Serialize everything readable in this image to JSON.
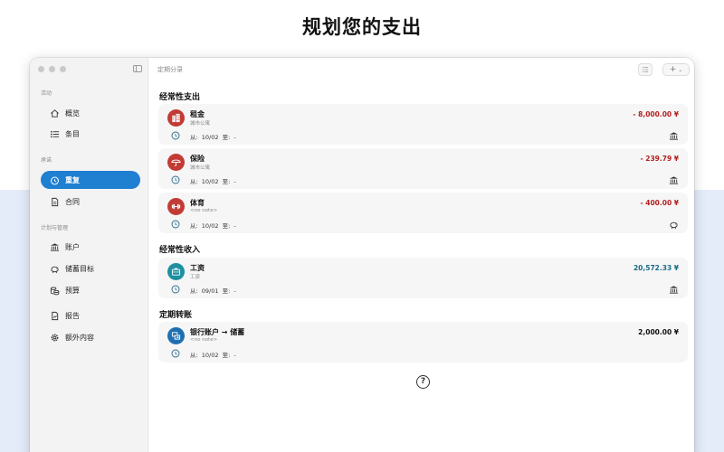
{
  "headline": "规划您的支出",
  "window": {
    "title": "定期分录"
  },
  "sidebar": {
    "sections": [
      {
        "label": "活动"
      },
      {
        "label": "承诺"
      },
      {
        "label": "计划与管理"
      }
    ],
    "items": [
      {
        "label": "概览",
        "icon": "home-icon"
      },
      {
        "label": "条目",
        "icon": "list-icon"
      },
      {
        "label": "重复",
        "icon": "repeat-clock-icon",
        "active": true
      },
      {
        "label": "合同",
        "icon": "document-icon"
      },
      {
        "label": "账户",
        "icon": "bank-icon"
      },
      {
        "label": "储蓄目标",
        "icon": "piggy-bank-icon"
      },
      {
        "label": "预算",
        "icon": "coins-icon"
      },
      {
        "label": "报告",
        "icon": "report-icon"
      },
      {
        "label": "额外内容",
        "icon": "gear-icon"
      }
    ]
  },
  "groups": [
    {
      "title": "经常性支出"
    },
    {
      "title": "经常性收入"
    },
    {
      "title": "定期转账"
    }
  ],
  "entries": [
    {
      "name": "租金",
      "sub": "城市公寓",
      "amount": "- 8,000.00 ¥",
      "from_label": "从:",
      "from": "10/02",
      "to_label": "至:",
      "to": "-",
      "icon": "building-icon",
      "account_icon": "bank-icon"
    },
    {
      "name": "保险",
      "sub": "城市公寓",
      "amount": "- 239.79 ¥",
      "from_label": "从:",
      "from": "10/02",
      "to_label": "至:",
      "to": "-",
      "icon": "umbrella-icon",
      "account_icon": "bank-icon"
    },
    {
      "name": "体育",
      "sub": "<no note>",
      "amount": "- 400.00 ¥",
      "from_label": "从:",
      "from": "10/02",
      "to_label": "至:",
      "to": "-",
      "icon": "dumbbell-icon",
      "account_icon": "piggy-bank-icon"
    },
    {
      "name": "工资",
      "sub": "工资",
      "amount": "20,572.33 ¥",
      "from_label": "从:",
      "from": "09/01",
      "to_label": "至:",
      "to": "-",
      "icon": "briefcase-icon",
      "account_icon": "bank-icon"
    },
    {
      "name": "银行账户 → 储蓄",
      "sub": "<no note>",
      "amount": "2,000.00 ¥",
      "from_label": "从:",
      "from": "10/02",
      "to_label": "至:",
      "to": "-",
      "icon": "transfer-icon",
      "account_icon": ""
    }
  ],
  "toolbar": {
    "add_label": "+",
    "add_caret": "⌄"
  },
  "help": {
    "label": "?"
  },
  "colors": {
    "accent": "#1f7fd1",
    "expense": "#b32020",
    "income": "#1b6a86",
    "transfer": "#111111",
    "expense_icon_bg": "#c23b34",
    "income_icon_bg": "#1f8fa0",
    "transfer_icon_bg": "#1f6fb0"
  }
}
